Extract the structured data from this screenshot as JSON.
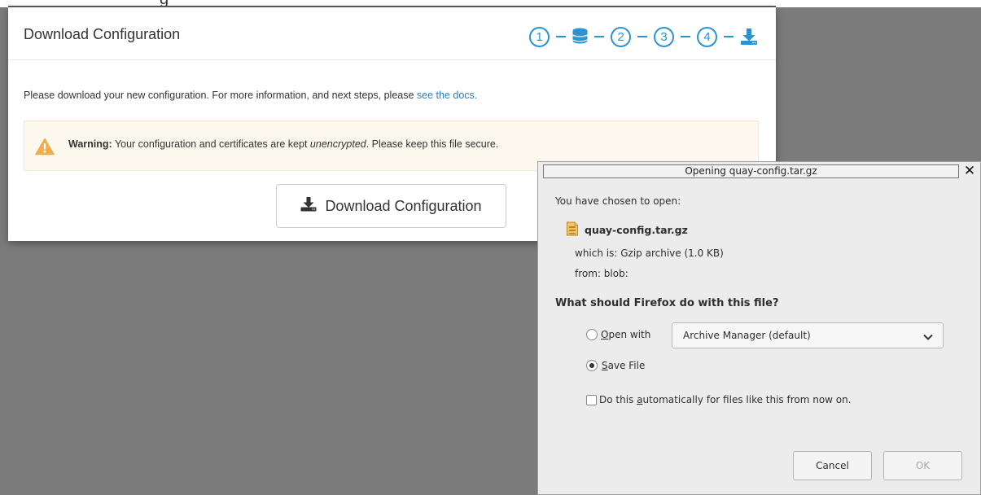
{
  "background": {
    "cut_title": "g"
  },
  "modal": {
    "title": "Download Configuration",
    "steps": [
      {
        "type": "number",
        "label": "1"
      },
      {
        "type": "icon",
        "icon": "database-icon"
      },
      {
        "type": "number",
        "label": "2"
      },
      {
        "type": "number",
        "label": "3"
      },
      {
        "type": "number",
        "label": "4"
      },
      {
        "type": "icon",
        "icon": "download-icon"
      }
    ],
    "intro_text": "Please download your new configuration. For more information, and next steps, please ",
    "intro_link": "see the docs.",
    "warning": {
      "bold": "Warning:",
      "text_before": " Your configuration and certificates are kept ",
      "emphasis": "unencrypted",
      "text_after": ". Please keep this file secure."
    },
    "download_button": "Download Configuration",
    "colors": {
      "accent": "#2a93d5",
      "warning_bg": "#fcf8ee",
      "warning_icon": "#f0ad4e"
    }
  },
  "dialog": {
    "title": "Opening quay-config.tar.gz",
    "chosen_label": "You have chosen to open:",
    "file_name": "quay-config.tar.gz",
    "which_is_label": "which is:",
    "which_is_value": "Gzip archive (1.0 KB)",
    "from_label": "from:",
    "from_value": "blob:",
    "question": "What should Firefox do with this file?",
    "open_with": {
      "prefix": "",
      "accel": "O",
      "rest": "pen with",
      "selected": false
    },
    "app_select": "Archive Manager (default)",
    "save_file": {
      "accel": "S",
      "rest": "ave File",
      "selected": true
    },
    "auto": {
      "before": "Do this ",
      "accel": "a",
      "after": "utomatically for files like this from now on.",
      "checked": false
    },
    "cancel": "Cancel",
    "ok": "OK"
  }
}
